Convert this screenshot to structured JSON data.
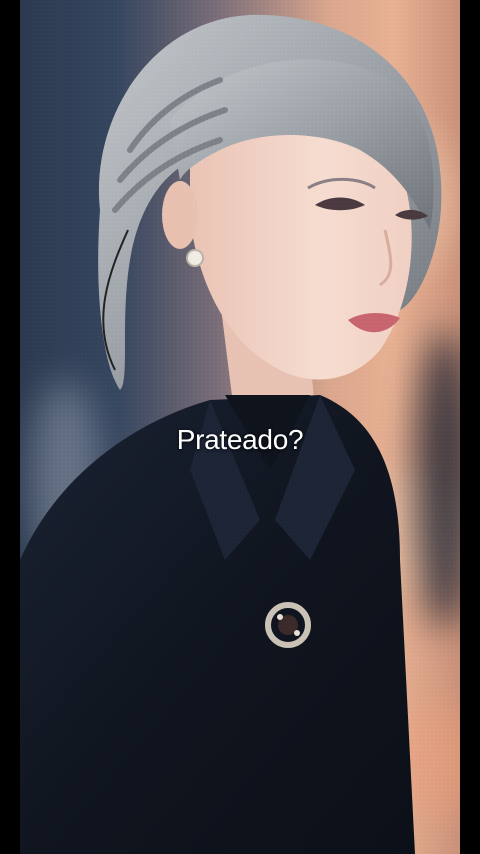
{
  "video": {
    "caption": "Prateado?",
    "accent": "#ffffff"
  },
  "scene": {
    "palette": {
      "background_cool": "#2c3a50",
      "background_warm": "#e7b092",
      "hair": "#9aa0a6",
      "jacket": "#10151f",
      "skin": "#f2d2c4",
      "lips": "#c8646e"
    }
  }
}
